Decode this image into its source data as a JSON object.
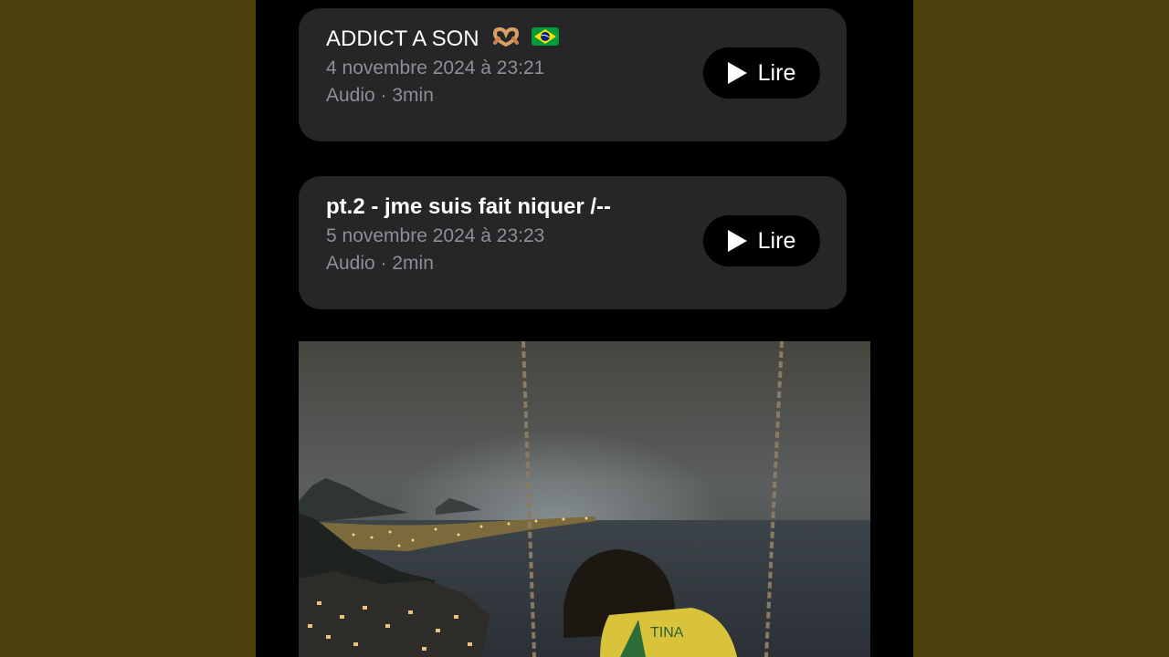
{
  "cards": [
    {
      "title": "ADDICT A SON",
      "emoji": [
        "hand-heart-emoji",
        "brazil-flag-emoji"
      ],
      "date": "4 novembre 2024 à 23:21",
      "meta": "Audio · 3min",
      "button_label": "Lire"
    },
    {
      "title": "pt.2 - jme suis fait niquer /--",
      "date": "5 novembre 2024 à 23:23",
      "meta": "Audio · 2min",
      "button_label": "Lire"
    }
  ],
  "photo": {
    "jersey_text": "TINA"
  },
  "colors": {
    "background": "#4a400c",
    "card": "#262628",
    "secondary_text": "#8e8e93"
  }
}
